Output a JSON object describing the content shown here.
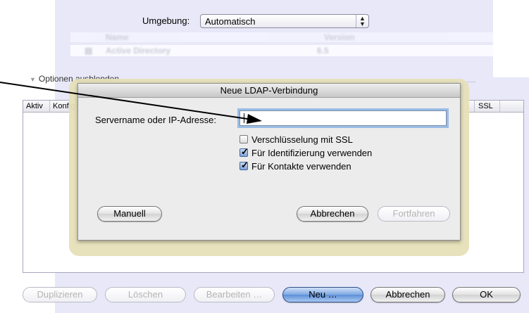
{
  "environment": {
    "label": "Umgebung:",
    "value": "Automatisch",
    "arrows_glyph": "▲▼"
  },
  "background_list": {
    "col_name": "Name",
    "col_version": "Version",
    "row_name": "Active Directory",
    "row_version": "6.5"
  },
  "options": {
    "toggle_label": "Optionen ausblenden",
    "table_headers": {
      "aktiv": "Aktiv",
      "konfig": "Konfig",
      "ssl": "SSL"
    }
  },
  "dialog": {
    "title": "Neue LDAP-Verbindung",
    "server_label": "Servername oder IP-Adresse:",
    "server_value": "",
    "checkboxes": [
      {
        "label": "Verschlüsselung mit SSL",
        "checked": false
      },
      {
        "label": "Für Identifizierung verwenden",
        "checked": true
      },
      {
        "label": "Für Kontakte verwenden",
        "checked": true
      }
    ],
    "manual_button": "Manuell",
    "cancel_button": "Abbrechen",
    "continue_button": "Fortfahren"
  },
  "bottom_buttons": {
    "duplicate": "Duplizieren",
    "delete": "Löschen",
    "edit": "Bearbeiten …",
    "new": "Neu …",
    "cancel": "Abbrechen",
    "ok": "OK"
  },
  "colors": {
    "accent_focus": "#9bbce6",
    "default_button": "#5d8fd6",
    "background_panel": "#e8e8f8"
  }
}
